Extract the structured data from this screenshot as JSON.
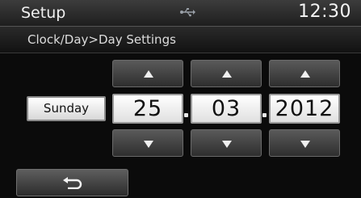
{
  "header": {
    "title": "Setup",
    "clock": "12:30",
    "status_icon": "usb-icon"
  },
  "breadcrumb": {
    "text": "Clock/Day>Day Settings"
  },
  "settings": {
    "day_label": "Sunday",
    "day": "25",
    "month": "03",
    "year": "2012"
  },
  "icons": {
    "increment": "up-arrow-icon",
    "decrement": "down-arrow-icon",
    "back": "back-arrow-icon"
  }
}
